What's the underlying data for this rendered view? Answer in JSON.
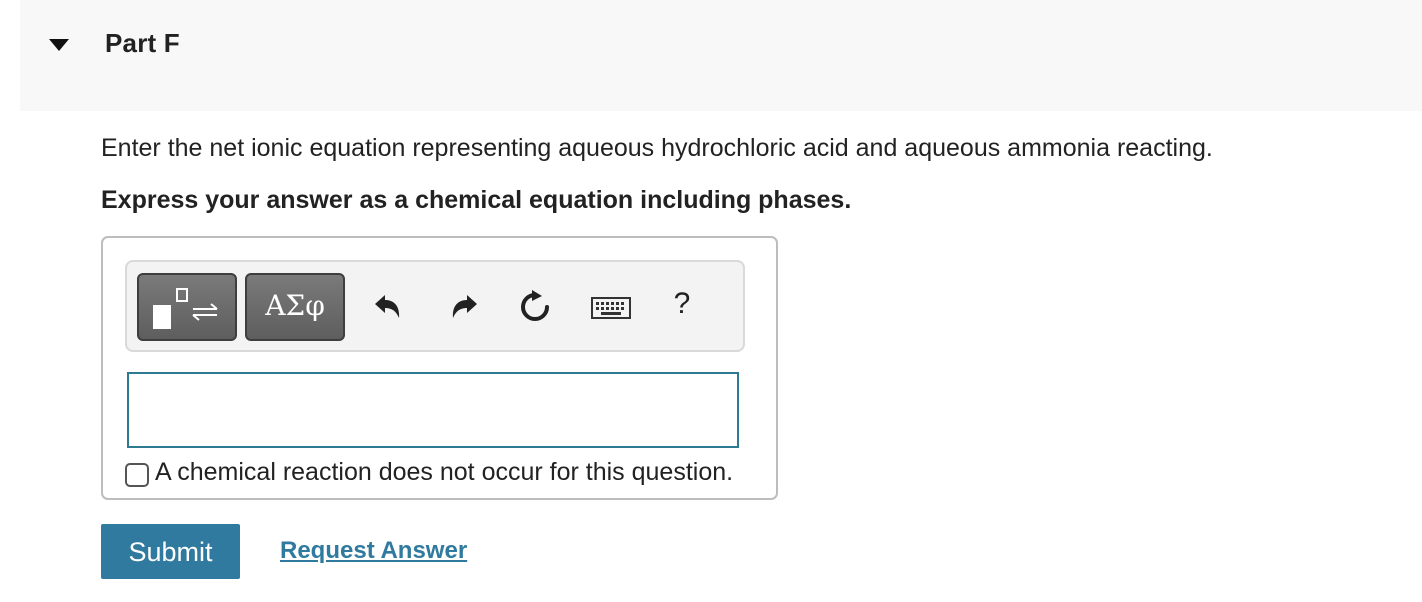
{
  "part": {
    "title": "Part F",
    "toggle_icon": "triangle-down-icon"
  },
  "question": {
    "prompt": "Enter the net ionic equation representing aqueous hydrochloric acid and aqueous ammonia reacting.",
    "instruction": "Express your answer as a chemical equation including phases."
  },
  "toolbar": {
    "templates_icon": "templates-icon",
    "symbols_label": "ΑΣφ",
    "undo_icon": "undo-icon",
    "redo_icon": "redo-icon",
    "reset_icon": "reset-icon",
    "keyboard_icon": "keyboard-icon",
    "help_label": "?"
  },
  "answer": {
    "value": "",
    "placeholder": ""
  },
  "no_reaction": {
    "checked": false,
    "label": "A chemical reaction does not occur for this question."
  },
  "actions": {
    "submit_label": "Submit",
    "request_answer_label": "Request Answer"
  },
  "colors": {
    "accent": "#2f7a9e",
    "header_bg": "#f8f8f8",
    "toolbar_bg": "#f3f3f3"
  }
}
